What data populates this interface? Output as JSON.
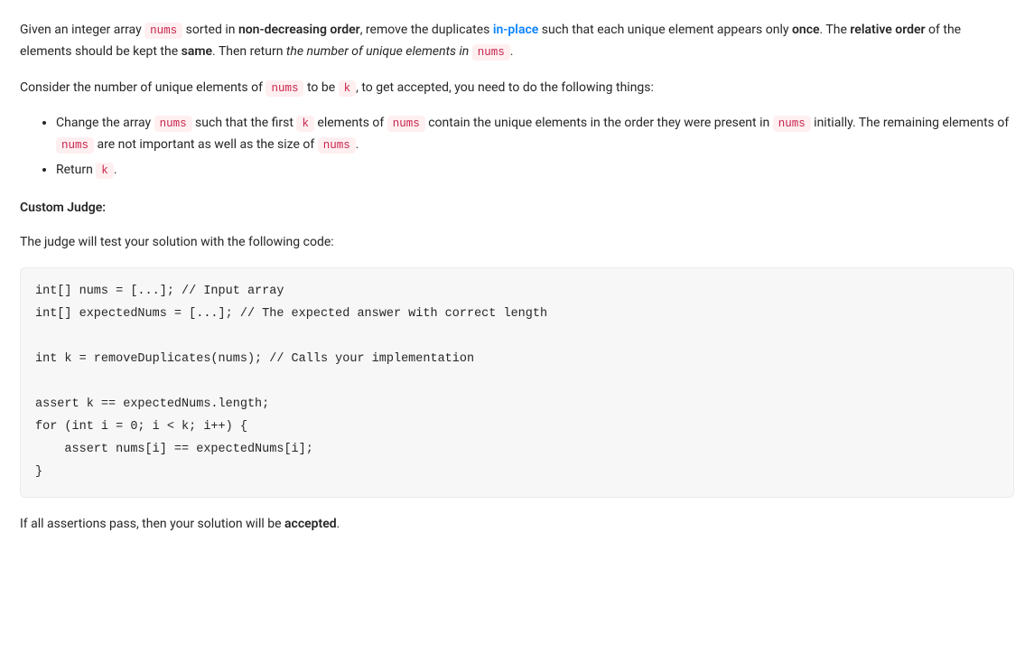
{
  "para1": {
    "t1": "Given an integer array ",
    "c1": "nums",
    "t2": " sorted in ",
    "b1": "non-decreasing order",
    "t3": ", remove the duplicates ",
    "link": "in-place",
    "t4": " such that each unique element appears only ",
    "b2": "once",
    "t5": ". The ",
    "b3": "relative order",
    "t6": " of the elements should be kept the ",
    "b4": "same",
    "t7": ". Then return ",
    "i1": "the number of unique elements in ",
    "c2": "nums",
    "t8": "."
  },
  "para2": {
    "t1": "Consider the number of unique elements of ",
    "c1": "nums",
    "t2": " to be ",
    "c2": "k",
    "t3": ", to get accepted, you need to do the following things:"
  },
  "list": [
    {
      "t1": "Change the array ",
      "c1": "nums",
      "t2": " such that the first ",
      "c2": "k",
      "t3": " elements of ",
      "c3": "nums",
      "t4": " contain the unique elements in the order they were present in ",
      "c4": "nums",
      "t5": " initially. The remaining elements of ",
      "c5": "nums",
      "t6": " are not important as well as the size of ",
      "c6": "nums",
      "t7": "."
    },
    {
      "t1": "Return ",
      "c1": "k",
      "t2": "."
    }
  ],
  "customJudgeTitle": "Custom Judge:",
  "para3": "The judge will test your solution with the following code:",
  "code": "int[] nums = [...]; // Input array\nint[] expectedNums = [...]; // The expected answer with correct length\n\nint k = removeDuplicates(nums); // Calls your implementation\n\nassert k == expectedNums.length;\nfor (int i = 0; i < k; i++) {\n    assert nums[i] == expectedNums[i];\n}",
  "para4": {
    "t1": "If all assertions pass, then your solution will be ",
    "b1": "accepted",
    "t2": "."
  }
}
